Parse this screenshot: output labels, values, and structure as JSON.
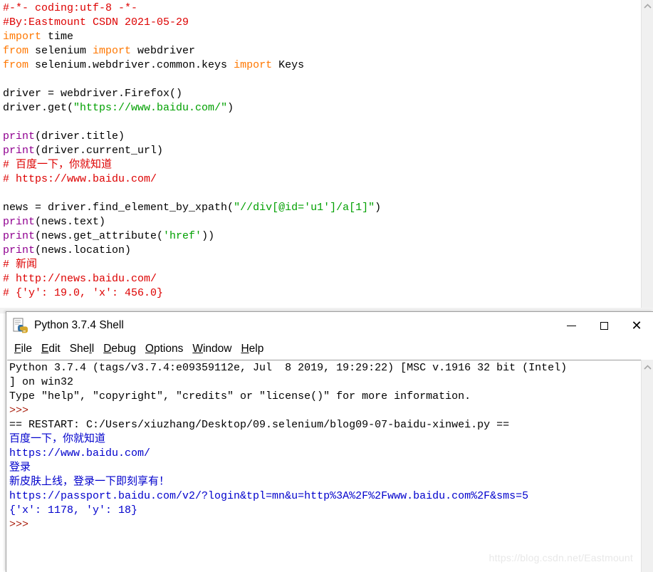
{
  "editor": {
    "name": "python-code-editor",
    "lines": [
      {
        "segments": [
          {
            "text": "#-*- coding:utf-8 -*-",
            "style": "cm"
          }
        ]
      },
      {
        "segments": [
          {
            "text": "#By:Eastmount CSDN 2021-05-29",
            "style": "cm"
          }
        ]
      },
      {
        "segments": [
          {
            "text": "import",
            "style": "kw"
          },
          {
            "text": " time",
            "style": "pl"
          }
        ]
      },
      {
        "segments": [
          {
            "text": "from",
            "style": "kw"
          },
          {
            "text": " selenium ",
            "style": "pl"
          },
          {
            "text": "import",
            "style": "kw"
          },
          {
            "text": " webdriver",
            "style": "pl"
          }
        ]
      },
      {
        "segments": [
          {
            "text": "from",
            "style": "kw"
          },
          {
            "text": " selenium.webdriver.common.keys ",
            "style": "pl"
          },
          {
            "text": "import",
            "style": "kw"
          },
          {
            "text": " Keys",
            "style": "pl"
          }
        ]
      },
      {
        "segments": []
      },
      {
        "segments": [
          {
            "text": "driver = webdriver.Firefox()",
            "style": "pl"
          }
        ]
      },
      {
        "segments": [
          {
            "text": "driver.get(",
            "style": "pl"
          },
          {
            "text": "\"https://www.baidu.com/\"",
            "style": "st"
          },
          {
            "text": ")",
            "style": "pl"
          }
        ]
      },
      {
        "segments": []
      },
      {
        "segments": [
          {
            "text": "print",
            "style": "bi"
          },
          {
            "text": "(driver.title)",
            "style": "pl"
          }
        ]
      },
      {
        "segments": [
          {
            "text": "print",
            "style": "bi"
          },
          {
            "text": "(driver.current_url)",
            "style": "pl"
          }
        ]
      },
      {
        "segments": [
          {
            "text": "# 百度一下，你就知道",
            "style": "cm"
          }
        ]
      },
      {
        "segments": [
          {
            "text": "# https://www.baidu.com/",
            "style": "cm"
          }
        ]
      },
      {
        "segments": []
      },
      {
        "segments": [
          {
            "text": "news = driver.find_element_by_xpath(",
            "style": "pl"
          },
          {
            "text": "\"//div[@id='u1']/a[1]\"",
            "style": "st"
          },
          {
            "text": ")",
            "style": "pl"
          }
        ]
      },
      {
        "segments": [
          {
            "text": "print",
            "style": "bi"
          },
          {
            "text": "(news.text)",
            "style": "pl"
          }
        ]
      },
      {
        "segments": [
          {
            "text": "print",
            "style": "bi"
          },
          {
            "text": "(news.get_attribute(",
            "style": "pl"
          },
          {
            "text": "'href'",
            "style": "st"
          },
          {
            "text": "))",
            "style": "pl"
          }
        ]
      },
      {
        "segments": [
          {
            "text": "print",
            "style": "bi"
          },
          {
            "text": "(news.location)",
            "style": "pl"
          }
        ]
      },
      {
        "segments": [
          {
            "text": "# 新闻",
            "style": "cm"
          }
        ]
      },
      {
        "segments": [
          {
            "text": "# http://news.baidu.com/",
            "style": "cm"
          }
        ]
      },
      {
        "segments": [
          {
            "text": "# {'y': 19.0, 'x': 456.0}",
            "style": "cm"
          }
        ]
      }
    ],
    "scrollbar": {
      "up_arrow": "⌃"
    }
  },
  "shell": {
    "title": "Python 3.7.4 Shell",
    "icon": "python-idle-icon",
    "menus": [
      {
        "label": "File",
        "accel": "F"
      },
      {
        "label": "Edit",
        "accel": "E"
      },
      {
        "label": "Shell",
        "accel": "l"
      },
      {
        "label": "Debug",
        "accel": "D"
      },
      {
        "label": "Options",
        "accel": "O"
      },
      {
        "label": "Window",
        "accel": "W"
      },
      {
        "label": "Help",
        "accel": "H"
      }
    ],
    "window_controls": {
      "minimize": "minimize-button",
      "maximize": "maximize-button",
      "close": "✕"
    },
    "output_lines": [
      {
        "text": "Python 3.7.4 (tags/v3.7.4:e09359112e, Jul  8 2019, 19:29:22) [MSC v.1916 32 bit (Intel)",
        "style": "sh-norm"
      },
      {
        "text": "] on win32",
        "style": "sh-norm"
      },
      {
        "text": "Type \"help\", \"copyright\", \"credits\" or \"license()\" for more information.",
        "style": "sh-norm"
      },
      {
        "text": ">>> ",
        "style": "sh-err"
      },
      {
        "text": "== RESTART: C:/Users/xiuzhang/Desktop/09.selenium/blog09-07-baidu-xinwei.py ==",
        "style": "sh-norm"
      },
      {
        "text": "百度一下，你就知道",
        "style": "sh-out"
      },
      {
        "text": "https://www.baidu.com/",
        "style": "sh-out"
      },
      {
        "text": "登录",
        "style": "sh-out"
      },
      {
        "text": "新皮肤上线，登录一下即刻享有！",
        "style": "sh-out"
      },
      {
        "text": "https://passport.baidu.com/v2/?login&tpl=mn&u=http%3A%2F%2Fwww.baidu.com%2F&sms=5",
        "style": "sh-out"
      },
      {
        "text": "{'x': 1178, 'y': 18}",
        "style": "sh-out"
      },
      {
        "text": ">>> ",
        "style": "sh-err"
      }
    ],
    "scrollbar": {
      "up_arrow": "⌃"
    }
  },
  "watermark": "https://blog.csdn.net/Eastmount",
  "colors": {
    "keyword": "#ff7700",
    "comment": "#dd0000",
    "string": "#00a000",
    "builtin": "#900090",
    "shell_stdout": "#0000cc",
    "shell_prompt": "#aa2211",
    "text": "#000000"
  }
}
